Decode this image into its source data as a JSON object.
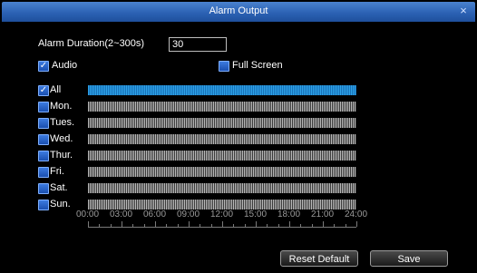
{
  "window": {
    "title": "Alarm  Output",
    "close_glyph": "×"
  },
  "duration": {
    "label": "Alarm  Duration(2~300s)",
    "value": "30"
  },
  "options": {
    "audio": {
      "label": "Audio",
      "checked": true
    },
    "full_screen": {
      "label": "Full Screen",
      "checked": false
    }
  },
  "schedule": {
    "rows": [
      {
        "label": "All",
        "checked": true,
        "active": true
      },
      {
        "label": "Mon.",
        "checked": false,
        "active": false
      },
      {
        "label": "Tues.",
        "checked": false,
        "active": false
      },
      {
        "label": "Wed.",
        "checked": false,
        "active": false
      },
      {
        "label": "Thur.",
        "checked": false,
        "active": false
      },
      {
        "label": "Fri.",
        "checked": false,
        "active": false
      },
      {
        "label": "Sat.",
        "checked": false,
        "active": false
      },
      {
        "label": "Sun.",
        "checked": false,
        "active": false
      }
    ],
    "time_labels": [
      "00:00",
      "03:00",
      "06:00",
      "09:00",
      "12:00",
      "15:00",
      "18:00",
      "21:00",
      "24:00"
    ]
  },
  "buttons": {
    "reset_label": "Reset  Default",
    "save_label": "Save"
  },
  "colors": {
    "title_bar": "#2c62b4",
    "active_bar": "#2ea4e8",
    "inactive_bar": "#b8b8b8"
  },
  "icons": {
    "checkbox": "checkbox-icon",
    "close": "close-icon"
  }
}
